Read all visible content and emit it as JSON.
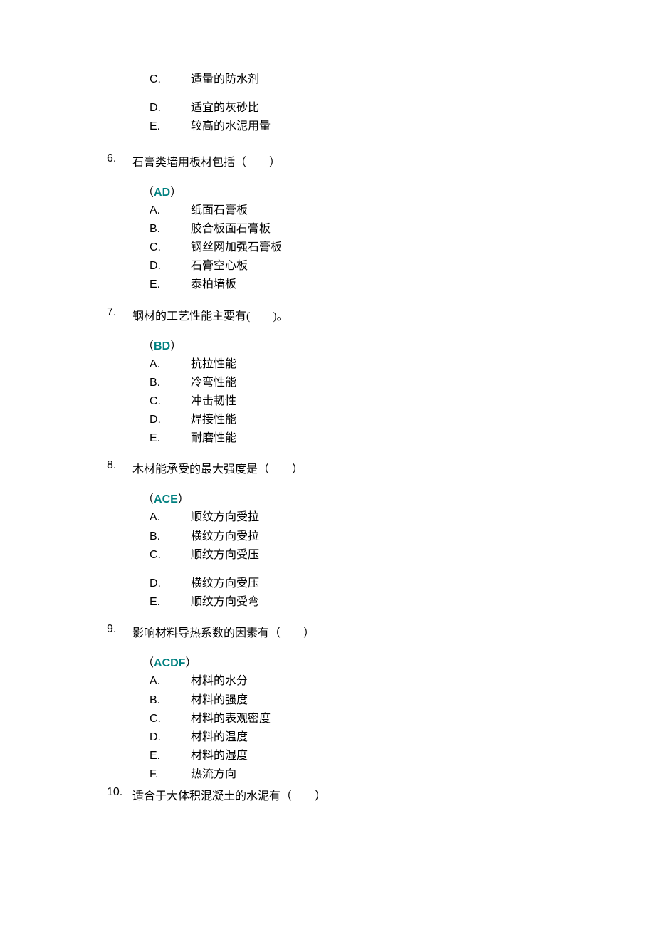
{
  "orphan": {
    "options": [
      {
        "letter": "C.",
        "text": "适量的防水剂"
      },
      {
        "letter": "D.",
        "text": "适宜的灰砂比"
      },
      {
        "letter": "E.",
        "text": "较高的水泥用量"
      }
    ]
  },
  "questions": [
    {
      "num": "6.",
      "text": "石膏类墙用板材包括（　　）",
      "answer": "AD",
      "options": [
        {
          "letter": "A.",
          "text": "纸面石膏板"
        },
        {
          "letter": "B.",
          "text": "  胶合板面石膏板"
        },
        {
          "letter": "C.",
          "text": " 钢丝网加强石膏板"
        },
        {
          "letter": "D.",
          "text": "  石膏空心板"
        },
        {
          "letter": "E.",
          "text": "泰柏墙板"
        }
      ]
    },
    {
      "num": "7.",
      "text": "钢材的工艺性能主要有(　　)。",
      "answer": "BD",
      "options": [
        {
          "letter": "A.",
          "text": "抗拉性能"
        },
        {
          "letter": "B.",
          "text": "冷弯性能"
        },
        {
          "letter": "C.",
          "text": "冲击韧性"
        },
        {
          "letter": "D.",
          "text": "焊接性能"
        },
        {
          "letter": "E.",
          "text": "耐磨性能"
        }
      ]
    },
    {
      "num": "8.",
      "text": "木材能承受的最大强度是（　　）",
      "answer": "ACE",
      "options_a": [
        {
          "letter": "A.",
          "text": "顺纹方向受拉"
        },
        {
          "letter": "B.",
          "text": "横纹方向受拉"
        },
        {
          "letter": "C.",
          "text": "顺纹方向受压"
        }
      ],
      "options_b": [
        {
          "letter": "D.",
          "text": "横纹方向受压"
        },
        {
          "letter": "E.",
          "text": "顺纹方向受弯"
        }
      ]
    },
    {
      "num": "9.",
      "text": "影响材料导热系数的因素有（　　）",
      "answer": "ACDF",
      "options": [
        {
          "letter": "A.",
          "text": "材料的水分"
        },
        {
          "letter": "B.",
          "text": "材料的强度"
        },
        {
          "letter": "C.",
          "text": "材料的表观密度"
        },
        {
          "letter": "D.",
          "text": "材料的温度"
        },
        {
          "letter": "E.",
          "text": "材料的湿度"
        },
        {
          "letter": "F.",
          "text": "热流方向"
        }
      ]
    },
    {
      "num": "10.",
      "text": "适合于大体积混凝土的水泥有（　　）"
    }
  ]
}
